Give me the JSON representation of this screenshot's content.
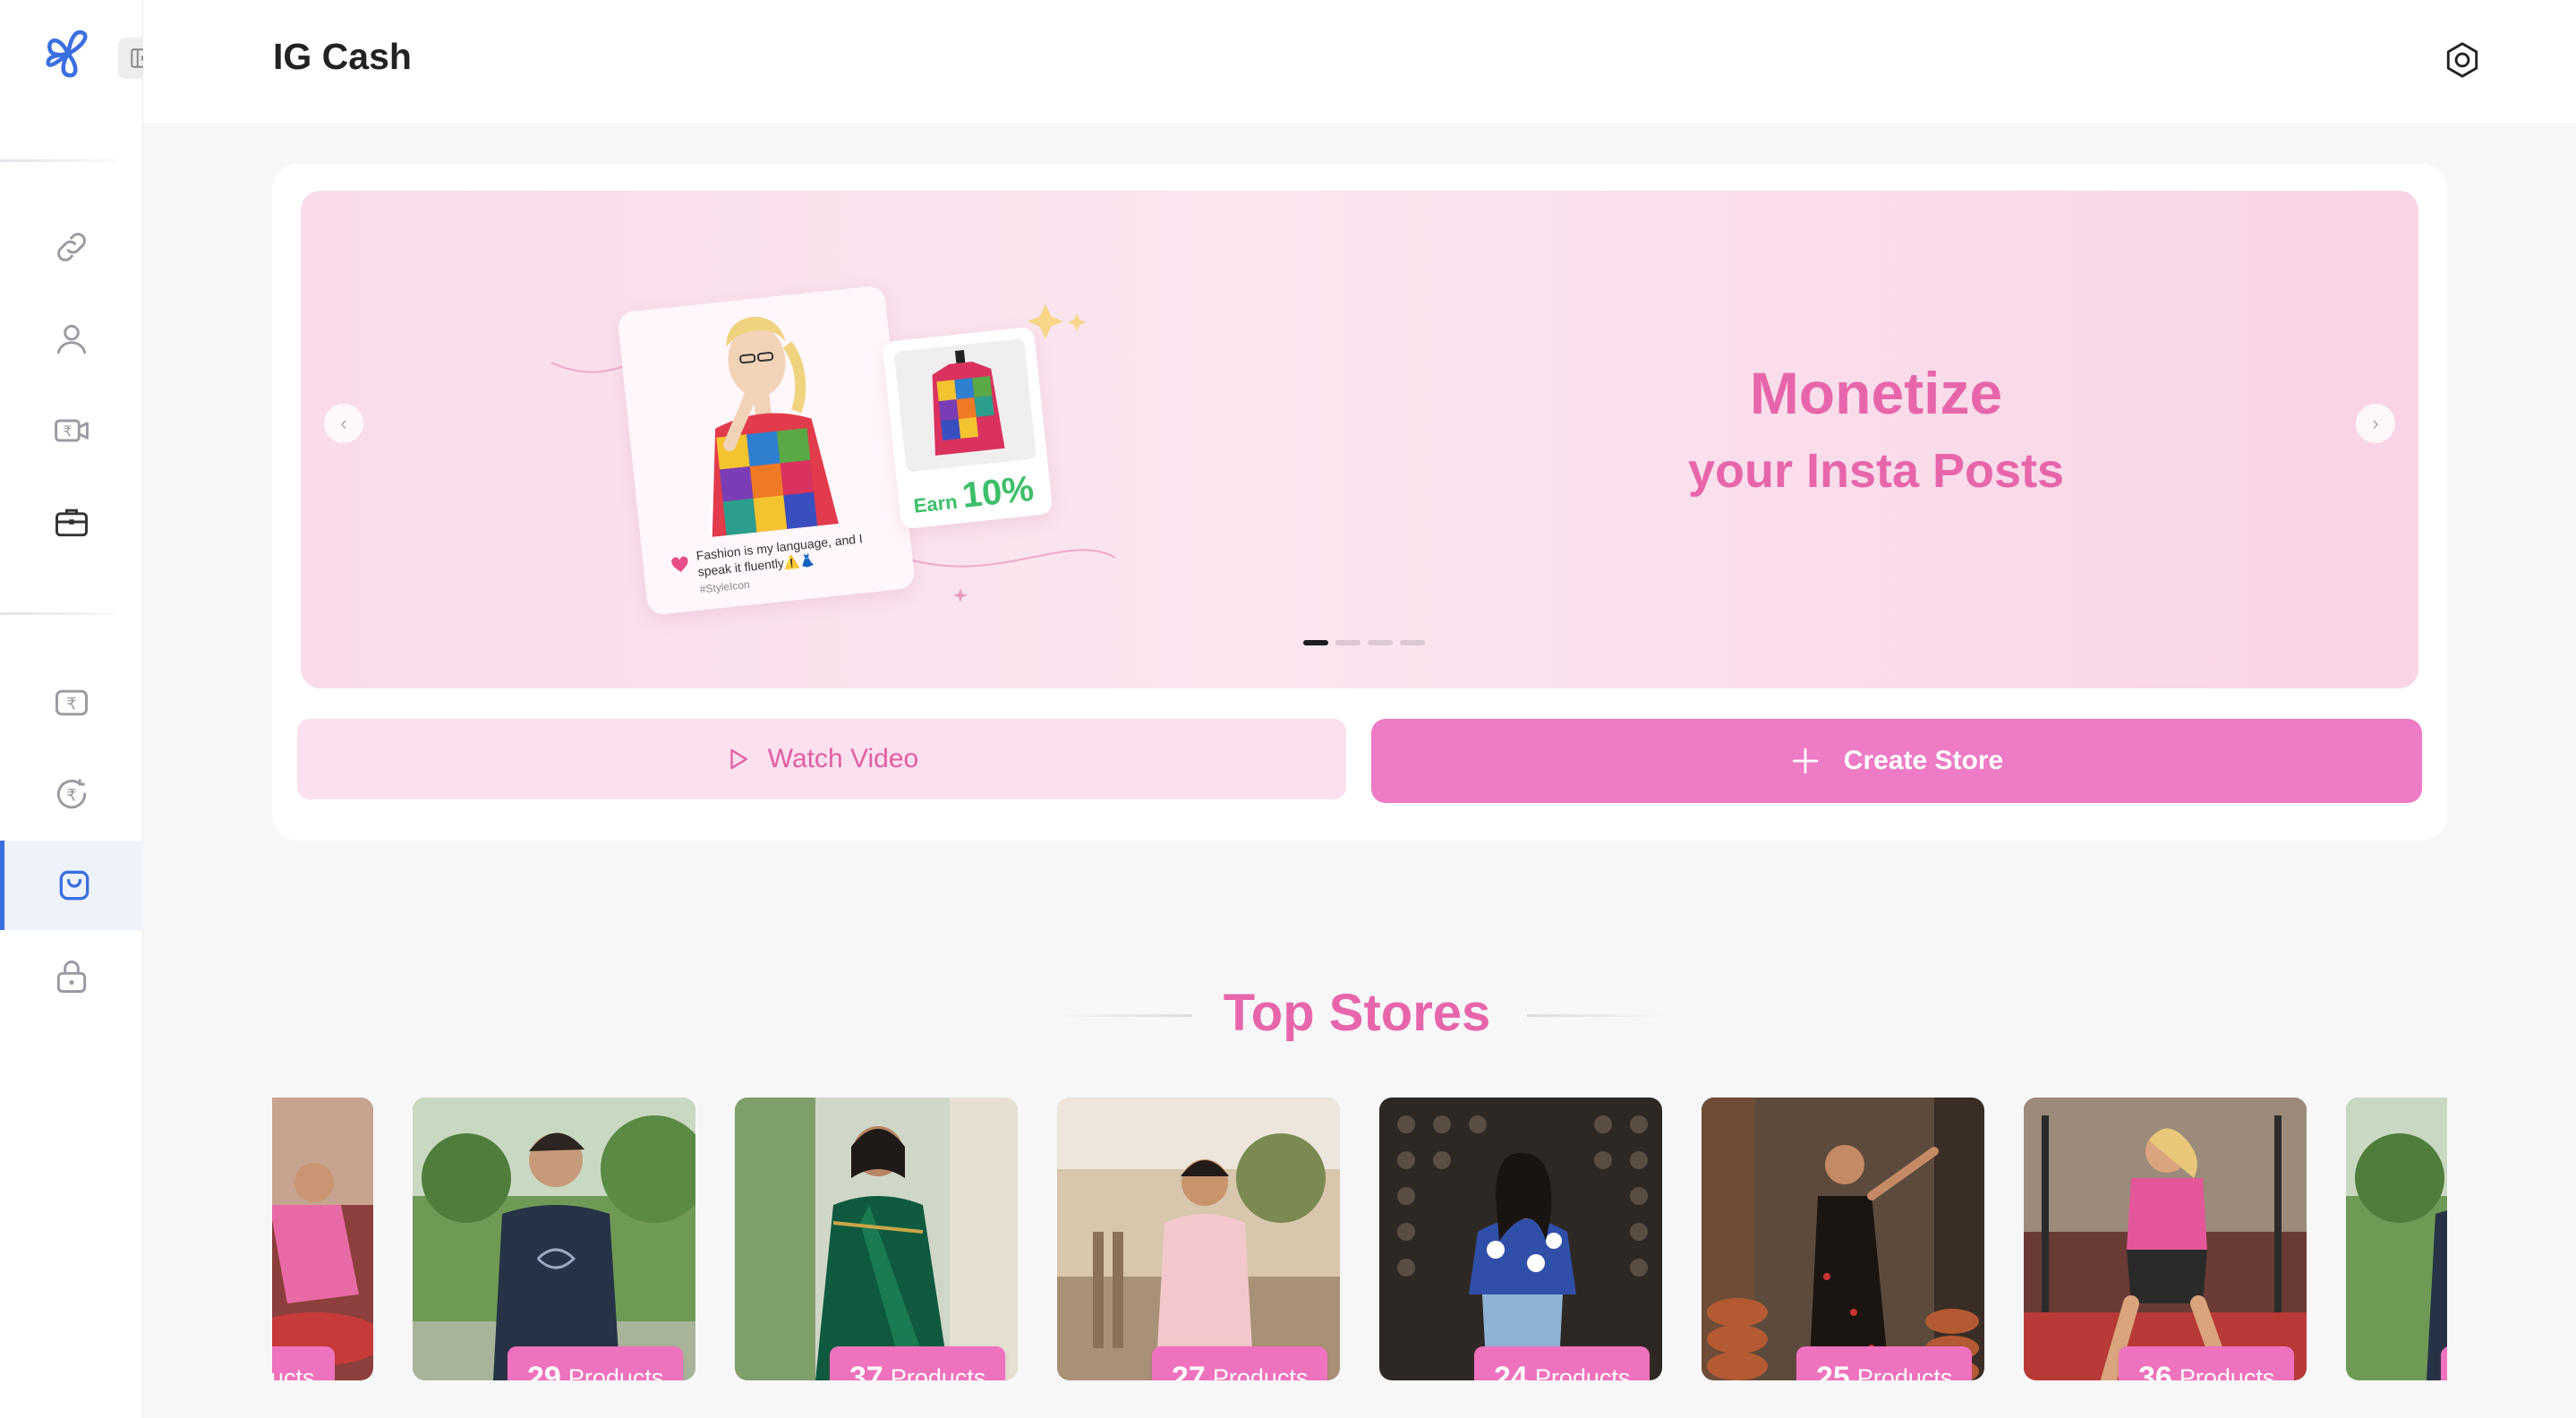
{
  "app": {
    "title": "IG Cash"
  },
  "banner": {
    "title": "Monetize",
    "subtitle": "your Insta Posts",
    "post_caption": "Fashion is my language, and I speak it fluently⚠️👗",
    "post_tag": "#StyleIcon",
    "earn_label": "Earn",
    "earn_percent": "10%",
    "slide_count": 4,
    "active_slide": 0
  },
  "actions": {
    "watch_video": "Watch Video",
    "create_store": "Create Store"
  },
  "top_stores": {
    "title": "Top Stores",
    "products_label": "Products",
    "partial_left_label": "roducts",
    "stores": [
      {
        "count": "29"
      },
      {
        "count": "37"
      },
      {
        "count": "27"
      },
      {
        "count": "24"
      },
      {
        "count": "25"
      },
      {
        "count": "36"
      }
    ]
  },
  "sidebar": {
    "items": [
      {
        "icon": "link-icon"
      },
      {
        "icon": "user-icon"
      },
      {
        "icon": "rupee-video-icon"
      },
      {
        "icon": "briefcase-icon"
      },
      {
        "icon": "rupee-card-icon"
      },
      {
        "icon": "rupee-cycle-icon"
      },
      {
        "icon": "shopping-bag-icon",
        "active": true
      },
      {
        "icon": "lock-icon"
      }
    ]
  },
  "colors": {
    "accent_pink": "#e766ab",
    "button_pink": "#ed7bc5",
    "active_blue": "#3b6fe0",
    "earn_green": "#3dbf6a"
  }
}
